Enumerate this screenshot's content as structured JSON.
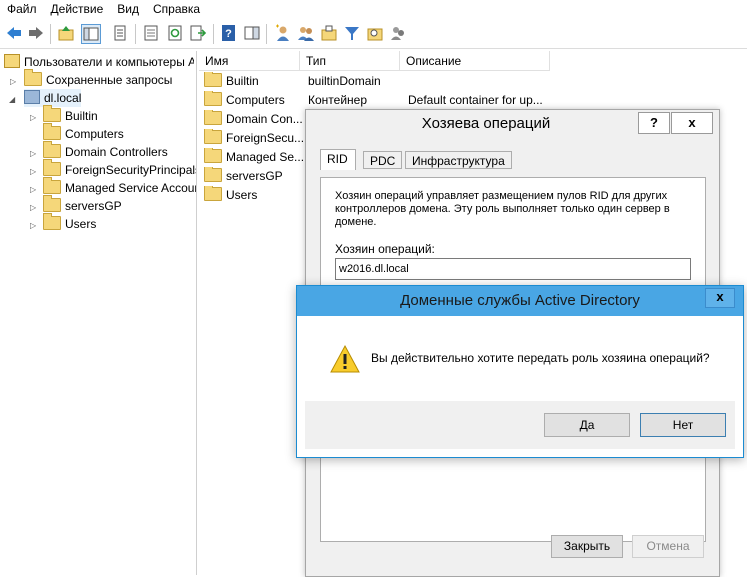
{
  "menu": [
    "Файл",
    "Действие",
    "Вид",
    "Справка"
  ],
  "toolbar_icons": [
    "back-arrow-icon",
    "forward-arrow-icon",
    "up-folder-icon",
    "show-console-tree-icon",
    "properties-icon",
    "export-list-icon",
    "refresh-icon",
    "export-icon",
    "help-icon",
    "action-pane-icon",
    "new-user-icon",
    "new-group-icon",
    "new-ou-icon",
    "filter-icon",
    "find-icon",
    "add-to-group-icon"
  ],
  "tree": {
    "root_label": "Пользователи и компьютеры Active Directory",
    "saved_queries": "Сохраненные запросы",
    "domain": "dl.local",
    "children": [
      "Builtin",
      "Computers",
      "Domain Controllers",
      "ForeignSecurityPrincipals",
      "Managed Service Accounts",
      "serversGP",
      "Users"
    ]
  },
  "list": {
    "columns": [
      "Имя",
      "Тип",
      "Описание"
    ],
    "rows": [
      {
        "name": "Builtin",
        "type": "builtinDomain",
        "desc": ""
      },
      {
        "name": "Computers",
        "type": "Контейнер",
        "desc": "Default container for up..."
      },
      {
        "name": "Domain Con...",
        "type": "",
        "desc": ""
      },
      {
        "name": "ForeignSecu...",
        "type": "",
        "desc": ""
      },
      {
        "name": "Managed Se...",
        "type": "",
        "desc": ""
      },
      {
        "name": "serversGP",
        "type": "",
        "desc": ""
      },
      {
        "name": "Users",
        "type": "",
        "desc": ""
      }
    ]
  },
  "ops_dialog": {
    "title": "Хозяева операций",
    "help_btn": "?",
    "close_btn": "x",
    "tabs": [
      "RID",
      "PDC",
      "Инфраструктура"
    ],
    "description": "Хозяин операций управляет размещением пулов RID для других контроллеров домена. Эту роль выполняет только один сервер в домене.",
    "owner_label": "Хозяин операций:",
    "owner_value": "w2016.dl.local",
    "close_label": "Закрыть",
    "cancel_label": "Отмена"
  },
  "confirm_dialog": {
    "title": "Доменные службы Active Directory",
    "close_btn": "x",
    "message": "Вы действительно хотите передать роль хозяина операций?",
    "yes_label": "Да",
    "no_label": "Нет"
  },
  "colors": {
    "confirm_title_bg": "#49a6e4",
    "folder": "#f5d77a"
  }
}
